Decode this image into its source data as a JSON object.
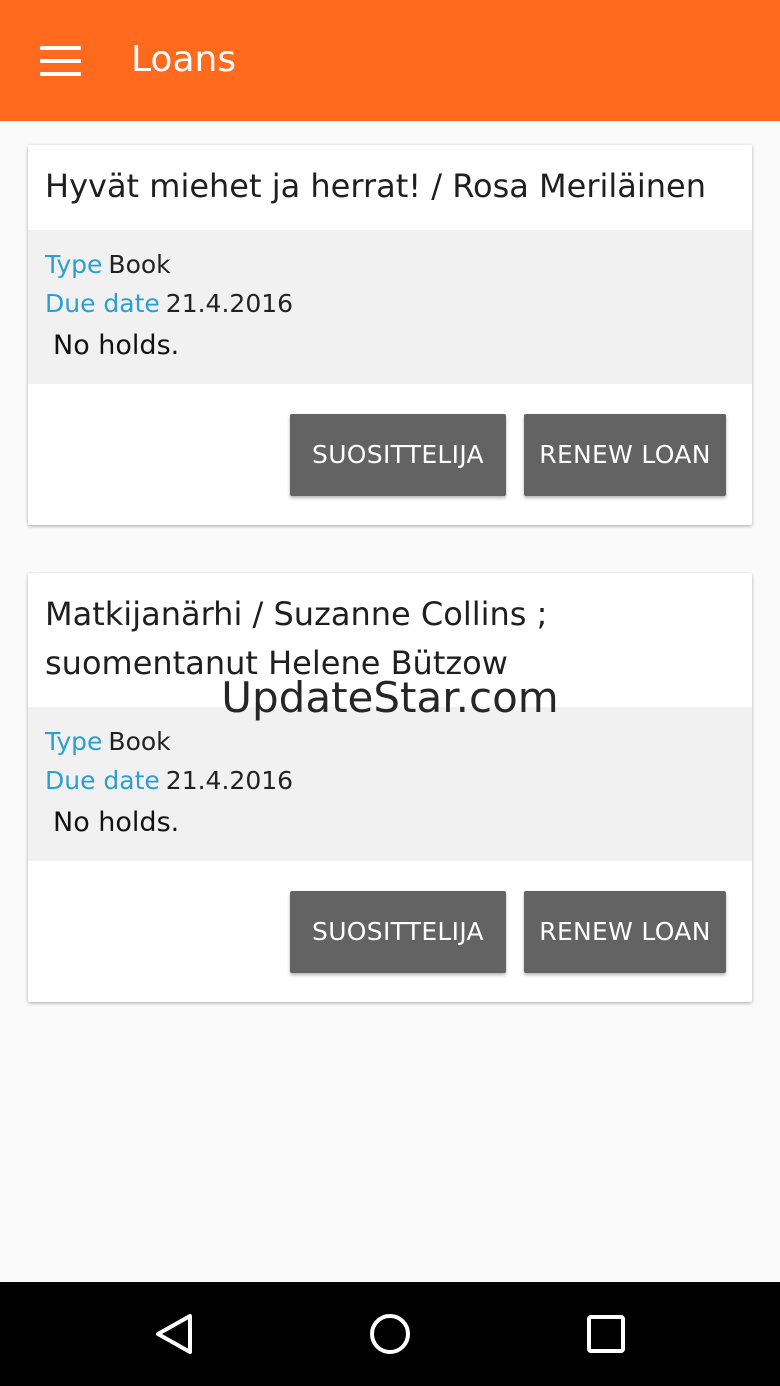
{
  "app_bar": {
    "title": "Loans",
    "menu_icon": "hamburger-menu-icon",
    "color": "#ff6a1f"
  },
  "loans": [
    {
      "title": "Hyvät miehet ja herrat! / Rosa Meriläinen",
      "type_label": "Type",
      "type_value": "Book",
      "due_label": "Due date",
      "due_value": "21.4.2016",
      "holds": "No holds.",
      "recommend_button": "SUOSITTELIJA",
      "renew_button": "RENEW LOAN"
    },
    {
      "title": "Matkijanärhi / Suzanne Collins ; suomentanut Helene Bützow",
      "type_label": "Type",
      "type_value": "Book",
      "due_label": "Due date",
      "due_value": "21.4.2016",
      "holds": "No holds.",
      "recommend_button": "SUOSITTELIJA",
      "renew_button": "RENEW LOAN"
    }
  ],
  "watermark": "UpdateStar.com",
  "nav_bar": {
    "back_icon": "back-triangle-icon",
    "home_icon": "home-circle-icon",
    "recents_icon": "recents-square-icon"
  }
}
